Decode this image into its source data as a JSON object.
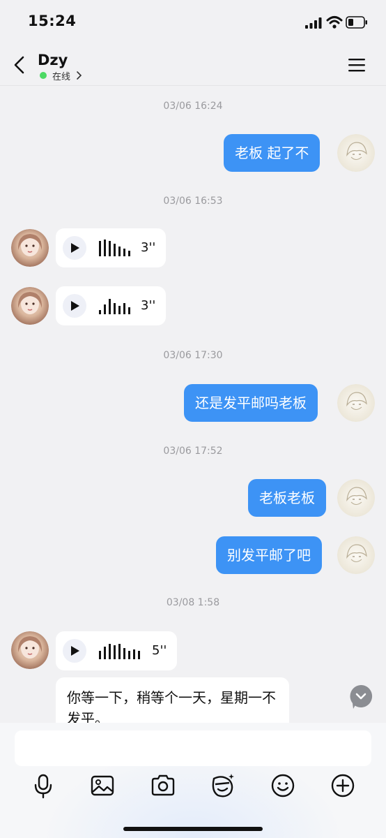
{
  "status_bar": {
    "time": "15:24"
  },
  "header": {
    "contact_name": "Dzy",
    "presence": "在线"
  },
  "messages": [
    {
      "timestamp": "03/06 16:24"
    },
    {
      "from": "me",
      "type": "text",
      "text": "老板  起了不"
    },
    {
      "timestamp": "03/06 16:53"
    },
    {
      "from": "contact",
      "type": "voice",
      "duration": "3''"
    },
    {
      "from": "contact",
      "type": "voice",
      "duration": "3''"
    },
    {
      "timestamp": "03/06 17:30"
    },
    {
      "from": "me",
      "type": "text",
      "text": "还是发平邮吗老板"
    },
    {
      "timestamp": "03/06 17:52"
    },
    {
      "from": "me",
      "type": "text",
      "text": "老板老板"
    },
    {
      "from": "me",
      "type": "text",
      "text": "别发平邮了吧"
    },
    {
      "timestamp": "03/08 1:58"
    },
    {
      "from": "contact",
      "type": "voice",
      "duration": "5''"
    },
    {
      "from": "contact",
      "type": "text",
      "text": "你等一下，稍等个一天，星期一不发平。"
    }
  ],
  "composer": {
    "placeholder": ""
  },
  "toolbar": [
    "mic-icon",
    "image-icon",
    "camera-icon",
    "sticker-icon",
    "emoji-icon",
    "plus-icon"
  ]
}
